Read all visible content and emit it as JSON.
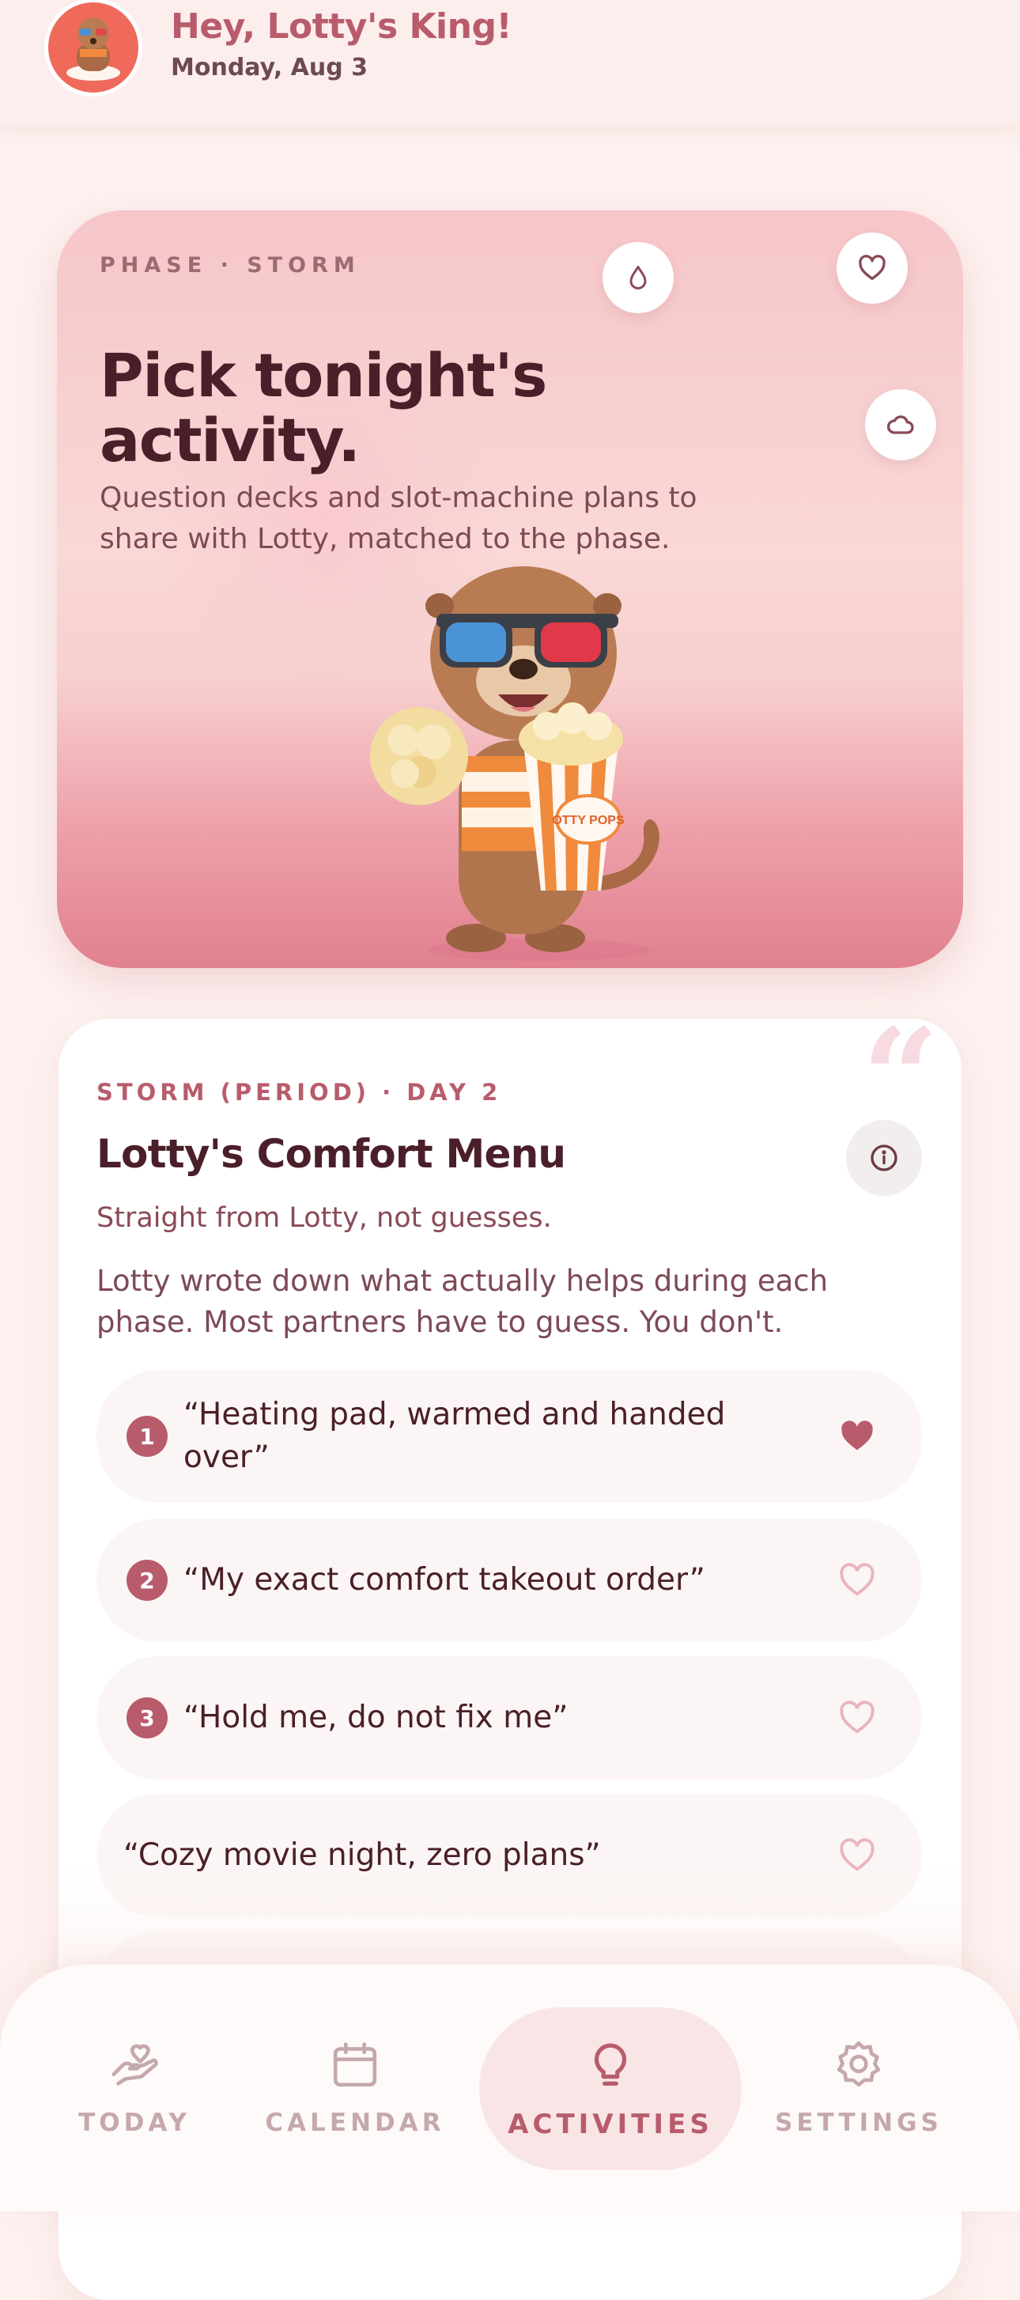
{
  "header": {
    "greeting": "Hey, Lotty's King!",
    "date": "Monday, Aug 3"
  },
  "hero": {
    "eyebrow": "PHASE · STORM",
    "title": "Pick tonight's activity.",
    "description": "Question decks and slot-machine plans to share with Lotty, matched to the phase.",
    "popcorn_label": "OTTY POPS"
  },
  "menu": {
    "eyebrow": "STORM (PERIOD) · DAY 2",
    "title": "Lotty's Comfort Menu",
    "subtitle": "Straight from Lotty, not guesses.",
    "description": "Lotty wrote down what actually helps during each phase. Most partners have to guess. You don't.",
    "items": [
      {
        "number": "1",
        "text": "“Heating pad, warmed and handed over”",
        "favorited": true
      },
      {
        "number": "2",
        "text": "“My exact comfort takeout order”",
        "favorited": false
      },
      {
        "number": "3",
        "text": "“Hold me, do not fix me”",
        "favorited": false
      },
      {
        "number": "",
        "text": "“Cozy movie night, zero plans”",
        "favorited": false
      }
    ]
  },
  "nav": {
    "items": [
      {
        "label": "TODAY",
        "icon": "hand-heart-icon"
      },
      {
        "label": "CALENDAR",
        "icon": "calendar-icon"
      },
      {
        "label": "ACTIVITIES",
        "icon": "lightbulb-icon",
        "active": true
      },
      {
        "label": "SETTINGS",
        "icon": "gear-icon"
      }
    ]
  },
  "colors": {
    "accent": "#b85c6c",
    "text_dark": "#4a1f2a",
    "background": "#fdf1ef"
  }
}
